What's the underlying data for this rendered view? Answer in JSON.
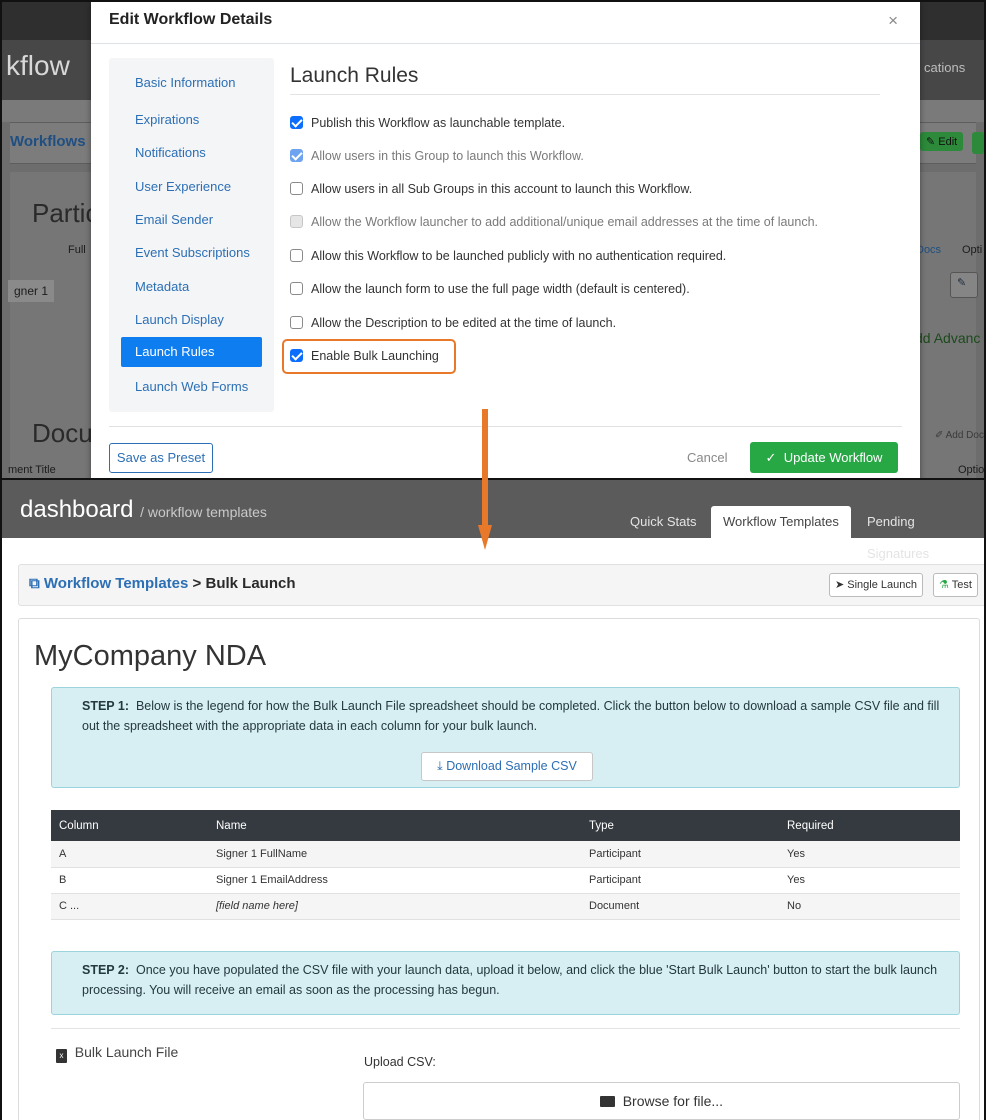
{
  "background": {
    "app_title": "kflow",
    "nav_right": "cations",
    "workflows_label": "Workflows",
    "edit_label": "Edit",
    "participants_heading": "Partic",
    "full_label": "Full",
    "signer_label": "gner 1",
    "docs_label": "Docs",
    "options_label": "Opti",
    "add_advanced": "dd Advanc",
    "documents_heading": "Docu",
    "document_title_col": "ment Title",
    "add_doc": "Add Doc",
    "options_label2": "Optio"
  },
  "modal": {
    "title": "Edit Workflow Details",
    "close": "×",
    "nav": [
      {
        "label": "Basic Information",
        "active": false
      },
      {
        "label": "Expirations",
        "active": false
      },
      {
        "label": "Notifications",
        "active": false
      },
      {
        "label": "User Experience",
        "active": false
      },
      {
        "label": "Email Sender",
        "active": false
      },
      {
        "label": "Event Subscriptions",
        "active": false
      },
      {
        "label": "Metadata",
        "active": false
      },
      {
        "label": "Launch Display",
        "active": false
      },
      {
        "label": "Launch Rules",
        "active": true
      },
      {
        "label": "Launch Web Forms",
        "active": false
      }
    ],
    "section_title": "Launch Rules",
    "rules": [
      {
        "label": "Publish this Workflow as launchable template.",
        "checked": true,
        "disabled": false
      },
      {
        "label": "Allow users in this Group to launch this Workflow.",
        "checked": true,
        "disabled": true
      },
      {
        "label": "Allow users in all Sub Groups in this account to launch this Workflow.",
        "checked": false,
        "disabled": false
      },
      {
        "label": "Allow the Workflow launcher to add additional/unique email addresses at the time of launch.",
        "checked": false,
        "disabled": true
      },
      {
        "label": "Allow this Workflow to be launched publicly with no authentication required.",
        "checked": false,
        "disabled": false
      },
      {
        "label": "Allow the launch form to use the full page width (default is centered).",
        "checked": false,
        "disabled": false
      },
      {
        "label": "Allow the Description to be edited at the time of launch.",
        "checked": false,
        "disabled": false
      },
      {
        "label": "Enable Bulk Launching",
        "checked": true,
        "disabled": false
      }
    ],
    "save_preset": "Save as Preset",
    "cancel": "Cancel",
    "update": "Update Workflow",
    "highlight_color": "#e8782a"
  },
  "dashboard": {
    "title": "dashboard",
    "subtitle": "/ workflow templates",
    "tabs": [
      {
        "label": "Quick Stats",
        "active": false
      },
      {
        "label": "Workflow Templates",
        "active": true
      },
      {
        "label": "Pending Signatures",
        "active": false
      }
    ],
    "breadcrumb": {
      "link": "Workflow Templates",
      "separator": ">",
      "current": "Bulk Launch"
    },
    "single_launch": "Single Launch",
    "test": "Test",
    "template_name": "MyCompany NDA",
    "step1": {
      "label": "STEP 1:",
      "text": "Below is the legend for how the Bulk Launch File spreadsheet should be completed. Click the button below to download a sample CSV file and fill out the spreadsheet with the appropriate data in each column for your bulk launch.",
      "button": "Download Sample CSV"
    },
    "table": {
      "headers": [
        "Column",
        "Name",
        "Type",
        "Required"
      ],
      "rows": [
        [
          "A",
          "Signer 1 FullName",
          "Participant",
          "Yes"
        ],
        [
          "B",
          "Signer 1 EmailAddress",
          "Participant",
          "Yes"
        ],
        [
          "C ...",
          "[field name here]",
          "Document",
          "No"
        ]
      ]
    },
    "step2": {
      "label": "STEP 2:",
      "text": "Once you have populated the CSV file with your launch data, upload it below, and click the blue 'Start Bulk Launch' button to start the bulk launch processing. You will receive an email as soon as the processing has begun."
    },
    "bulk_file_label": "Bulk Launch File",
    "upload_label": "Upload CSV:",
    "browse": "Browse for file..."
  }
}
